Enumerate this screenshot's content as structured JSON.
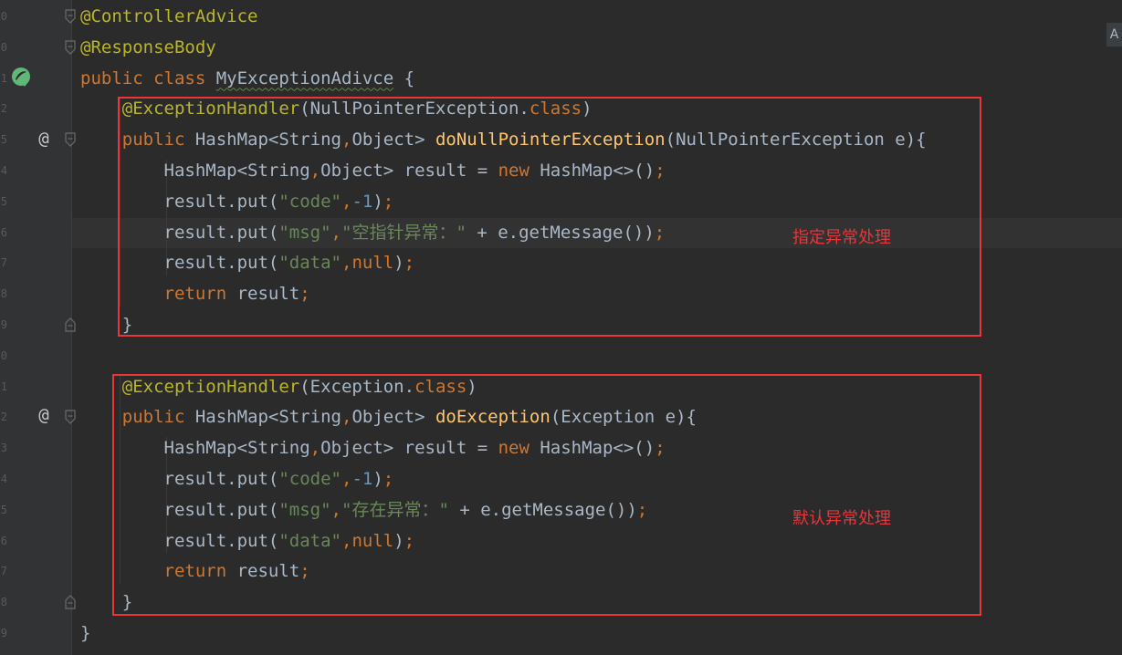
{
  "gutter": {
    "line_numbers": [
      "0",
      "0",
      "1",
      "2",
      "5",
      "4",
      "5",
      "6",
      "7",
      "8",
      "9",
      "0",
      "1",
      "2",
      "3",
      "4",
      "5",
      "6",
      "7",
      "8",
      "9"
    ]
  },
  "editor": {
    "reader_mode_label": "A",
    "lines": [
      [
        {
          "t": "@ControllerAdvice",
          "c": "ann"
        }
      ],
      [
        {
          "t": "@ResponseBody",
          "c": "ann"
        }
      ],
      [
        {
          "t": "public class ",
          "c": "kw"
        },
        {
          "t": "MyExceptionAdivce",
          "c": "plain wavy"
        },
        {
          "t": " {",
          "c": "plain"
        }
      ],
      [
        {
          "t": "    @ExceptionHandler",
          "c": "ann"
        },
        {
          "t": "(NullPointerException.",
          "c": "plain"
        },
        {
          "t": "class",
          "c": "kw"
        },
        {
          "t": ")",
          "c": "plain"
        }
      ],
      [
        {
          "t": "    public ",
          "c": "kw"
        },
        {
          "t": "HashMap<String",
          "c": "plain"
        },
        {
          "t": ",",
          "c": "kw"
        },
        {
          "t": "Object> ",
          "c": "plain"
        },
        {
          "t": "doNullPointerException",
          "c": "fn"
        },
        {
          "t": "(NullPointerException e){",
          "c": "plain"
        }
      ],
      [
        {
          "t": "        HashMap<String",
          "c": "plain"
        },
        {
          "t": ",",
          "c": "kw"
        },
        {
          "t": "Object> result = ",
          "c": "plain"
        },
        {
          "t": "new ",
          "c": "kw"
        },
        {
          "t": "HashMap<>()",
          "c": "plain"
        },
        {
          "t": ";",
          "c": "kw"
        }
      ],
      [
        {
          "t": "        result.put(",
          "c": "plain"
        },
        {
          "t": "\"code\"",
          "c": "str"
        },
        {
          "t": ",",
          "c": "kw"
        },
        {
          "t": "-1",
          "c": "num"
        },
        {
          "t": ")",
          "c": "plain"
        },
        {
          "t": ";",
          "c": "kw"
        }
      ],
      [
        {
          "t": "        result.put(",
          "c": "plain"
        },
        {
          "t": "\"msg\"",
          "c": "str"
        },
        {
          "t": ",",
          "c": "kw"
        },
        {
          "t": "\"空指针异常：\"",
          "c": "str"
        },
        {
          "t": " + e.getMessage())",
          "c": "plain"
        },
        {
          "t": ";",
          "c": "kw"
        }
      ],
      [
        {
          "t": "        result.put(",
          "c": "plain"
        },
        {
          "t": "\"data\"",
          "c": "str"
        },
        {
          "t": ",",
          "c": "kw"
        },
        {
          "t": "null",
          "c": "kw"
        },
        {
          "t": ")",
          "c": "plain"
        },
        {
          "t": ";",
          "c": "kw"
        }
      ],
      [
        {
          "t": "        return ",
          "c": "kw"
        },
        {
          "t": "result",
          "c": "plain"
        },
        {
          "t": ";",
          "c": "kw"
        }
      ],
      [
        {
          "t": "    }",
          "c": "plain"
        }
      ],
      [],
      [
        {
          "t": "    @ExceptionHandler",
          "c": "ann"
        },
        {
          "t": "(Exception.",
          "c": "plain"
        },
        {
          "t": "class",
          "c": "kw"
        },
        {
          "t": ")",
          "c": "plain"
        }
      ],
      [
        {
          "t": "    public ",
          "c": "kw"
        },
        {
          "t": "HashMap<String",
          "c": "plain"
        },
        {
          "t": ",",
          "c": "kw"
        },
        {
          "t": "Object> ",
          "c": "plain"
        },
        {
          "t": "doException",
          "c": "fn"
        },
        {
          "t": "(Exception e){",
          "c": "plain"
        }
      ],
      [
        {
          "t": "        HashMap<String",
          "c": "plain"
        },
        {
          "t": ",",
          "c": "kw"
        },
        {
          "t": "Object> result = ",
          "c": "plain"
        },
        {
          "t": "new ",
          "c": "kw"
        },
        {
          "t": "HashMap<>()",
          "c": "plain"
        },
        {
          "t": ";",
          "c": "kw"
        }
      ],
      [
        {
          "t": "        result.put(",
          "c": "plain"
        },
        {
          "t": "\"code\"",
          "c": "str"
        },
        {
          "t": ",",
          "c": "kw"
        },
        {
          "t": "-1",
          "c": "num"
        },
        {
          "t": ")",
          "c": "plain"
        },
        {
          "t": ";",
          "c": "kw"
        }
      ],
      [
        {
          "t": "        result.put(",
          "c": "plain"
        },
        {
          "t": "\"msg\"",
          "c": "str"
        },
        {
          "t": ",",
          "c": "kw"
        },
        {
          "t": "\"存在异常：\"",
          "c": "str"
        },
        {
          "t": " + e.getMessage())",
          "c": "plain"
        },
        {
          "t": ";",
          "c": "kw"
        }
      ],
      [
        {
          "t": "        result.put(",
          "c": "plain"
        },
        {
          "t": "\"data\"",
          "c": "str"
        },
        {
          "t": ",",
          "c": "kw"
        },
        {
          "t": "null",
          "c": "kw"
        },
        {
          "t": ")",
          "c": "plain"
        },
        {
          "t": ";",
          "c": "kw"
        }
      ],
      [
        {
          "t": "        return ",
          "c": "kw"
        },
        {
          "t": "result",
          "c": "plain"
        },
        {
          "t": ";",
          "c": "kw"
        }
      ],
      [
        {
          "t": "    }",
          "c": "plain"
        }
      ],
      [
        {
          "t": "}",
          "c": "plain"
        }
      ]
    ]
  },
  "annotations": {
    "box1_label": "指定异常处理",
    "box2_label": "默认异常处理"
  },
  "colors": {
    "background": "#2b2b2b",
    "annotation": "#bbb529",
    "keyword": "#cc7832",
    "string": "#6a8759",
    "number": "#6897bb",
    "method": "#ffc66d",
    "text": "#a9b7c6",
    "highlight_box": "#e8363a"
  },
  "icons": {
    "spring": "spring-bean-icon",
    "override": "override-at-icon",
    "fold": "fold-icon",
    "bulb": "lightbulb-icon"
  }
}
